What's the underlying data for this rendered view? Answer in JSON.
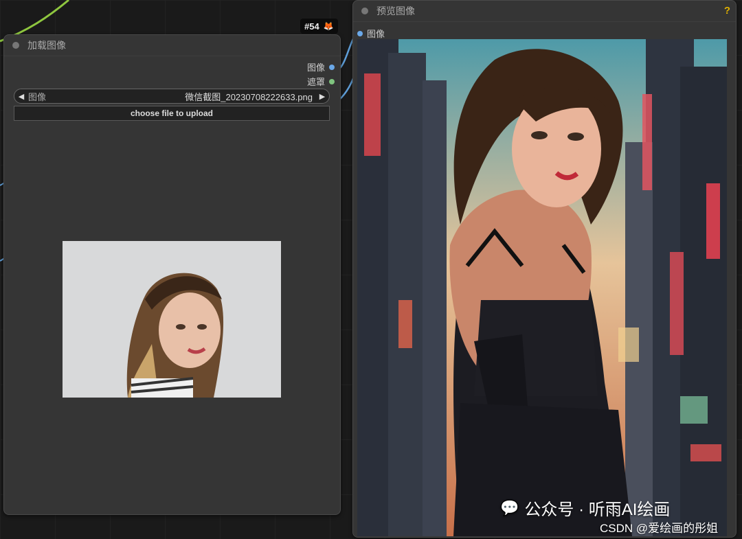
{
  "load_node": {
    "title": "加载图像",
    "outputs": [
      {
        "label": "图像",
        "color": "#6aa8e8"
      },
      {
        "label": "遮罩",
        "color": "#7fc47f"
      }
    ],
    "image_widget": {
      "label": "图像",
      "value": "微信截图_20230708222633.png"
    },
    "upload_button": "choose file to upload"
  },
  "preview_node": {
    "title": "预览图像",
    "input_label": "图像",
    "help": "?"
  },
  "node_badge": {
    "id": "#54",
    "icon": "fox-icon"
  },
  "watermark": {
    "line1": "公众号 · 听雨AI绘画",
    "line2": "CSDN @爱绘画的彤姐"
  },
  "colors": {
    "image_link": "#6aa8e8",
    "mask_link": "#7fc47f",
    "green_wire": "#8ec63f",
    "background": "#1a1a1a"
  }
}
